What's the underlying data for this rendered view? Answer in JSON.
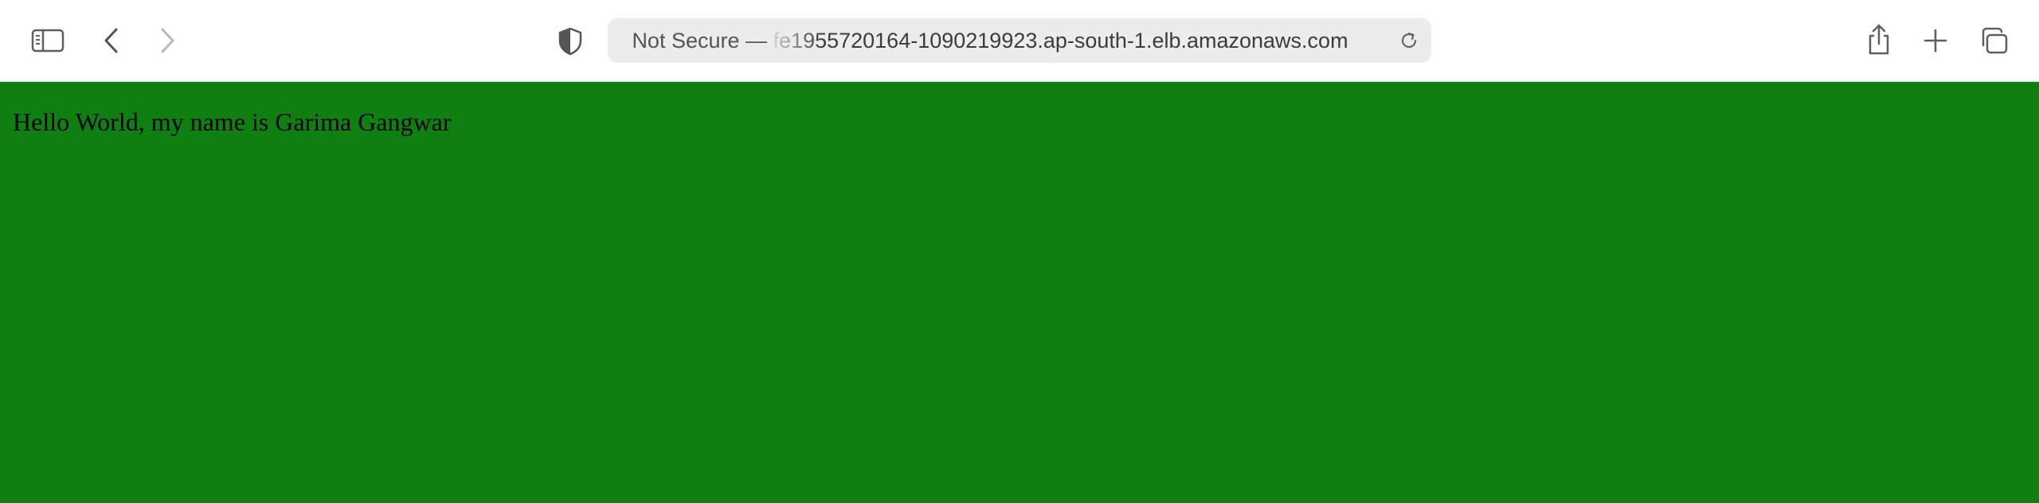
{
  "browser": {
    "address_bar": {
      "security_label": "Not Secure —",
      "url": "fe1955720164-1090219923.ap-south-1.elb.amazonaws.com"
    },
    "icons": {
      "sidebar": "sidebar-toggle-icon",
      "back": "chevron-left-icon",
      "forward": "chevron-right-icon",
      "privacy": "shield-icon",
      "reload": "reload-icon",
      "share": "share-icon",
      "new_tab": "plus-icon",
      "tab_overview": "tab-overview-icon"
    }
  },
  "page": {
    "background_color": "#107f12",
    "text": "Hello World, my name is Garima Gangwar"
  }
}
